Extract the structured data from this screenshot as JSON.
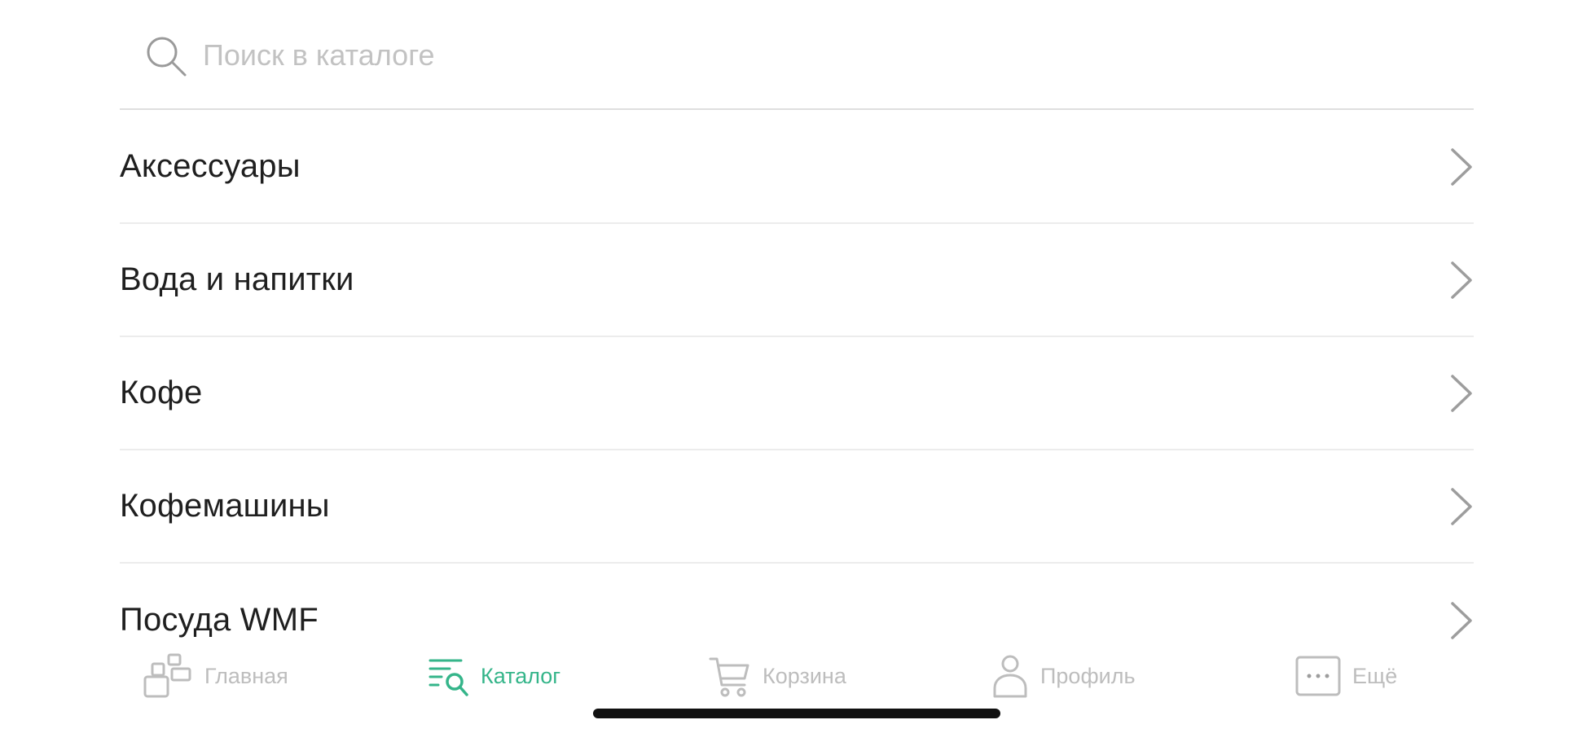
{
  "search": {
    "placeholder": "Поиск в каталоге",
    "value": ""
  },
  "categories": [
    {
      "label": "Аксессуары"
    },
    {
      "label": "Вода и напитки"
    },
    {
      "label": "Кофе"
    },
    {
      "label": "Кофемашины"
    },
    {
      "label": "Посуда WMF"
    }
  ],
  "tabbar": {
    "active_color": "#35b58a",
    "inactive_color": "#bdbdbd",
    "tabs": [
      {
        "label": "Главная",
        "icon": "home-icon",
        "active": false
      },
      {
        "label": "Каталог",
        "icon": "catalog-search-icon",
        "active": true
      },
      {
        "label": "Корзина",
        "icon": "cart-icon",
        "active": false
      },
      {
        "label": "Профиль",
        "icon": "profile-icon",
        "active": false
      },
      {
        "label": "Ещё",
        "icon": "more-icon",
        "active": false
      }
    ]
  }
}
